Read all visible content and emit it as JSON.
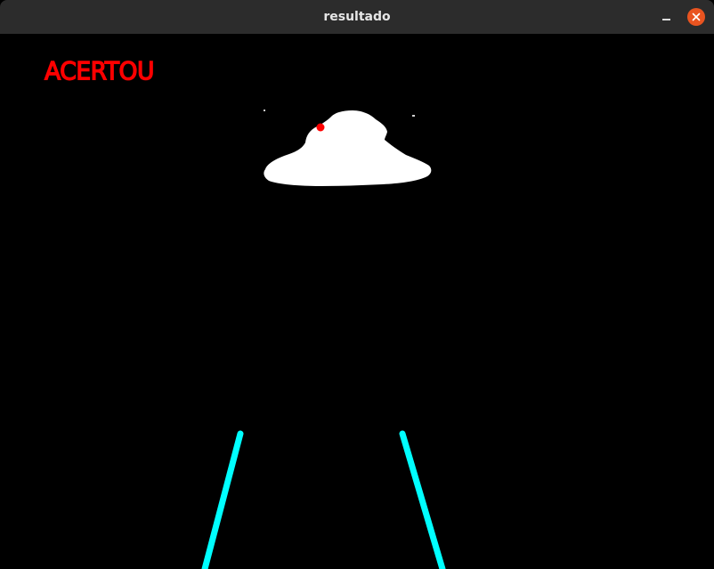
{
  "window": {
    "title": "resultado"
  },
  "titlebar_controls": {
    "minimize_icon": "minimize-icon",
    "close_icon": "close-icon",
    "close_color": "#e95420"
  },
  "overlay": {
    "status_text": "ACERTOU",
    "status_color": "#ff0000"
  },
  "colors": {
    "background": "#000000",
    "blob": "#ffffff",
    "marker": "#ff0000",
    "lane_lines": "#00ffff"
  }
}
